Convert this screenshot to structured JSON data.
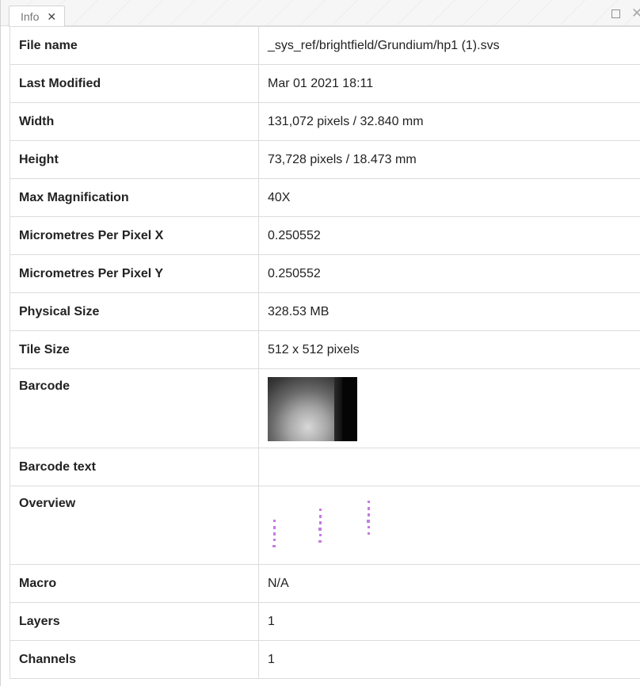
{
  "tab": {
    "label": "Info",
    "close_glyph": "✕"
  },
  "window": {
    "close_glyph": "✕"
  },
  "rows": [
    {
      "key": "File name",
      "value": "_sys_ref/brightfield/Grundium/hp1 (1).svs"
    },
    {
      "key": "Last Modified",
      "value": "Mar 01 2021 18:11"
    },
    {
      "key": "Width",
      "value": "131,072 pixels / 32.840 mm"
    },
    {
      "key": "Height",
      "value": "73,728 pixels / 18.473 mm"
    },
    {
      "key": "Max Magnification",
      "value": "40X"
    },
    {
      "key": "Micrometres Per Pixel X",
      "value": "0.250552"
    },
    {
      "key": "Micrometres Per Pixel Y",
      "value": "0.250552"
    },
    {
      "key": "Physical Size",
      "value": "328.53 MB"
    },
    {
      "key": "Tile Size",
      "value": "512 x 512 pixels"
    },
    {
      "key": "Barcode",
      "value": ""
    },
    {
      "key": "Barcode text",
      "value": ""
    },
    {
      "key": "Overview",
      "value": ""
    },
    {
      "key": "Macro",
      "value": "N/A"
    },
    {
      "key": "Layers",
      "value": "1"
    },
    {
      "key": "Channels",
      "value": "1"
    }
  ],
  "colors": {
    "overview_stain": "#b14fd6",
    "border": "#dcdcdc"
  }
}
